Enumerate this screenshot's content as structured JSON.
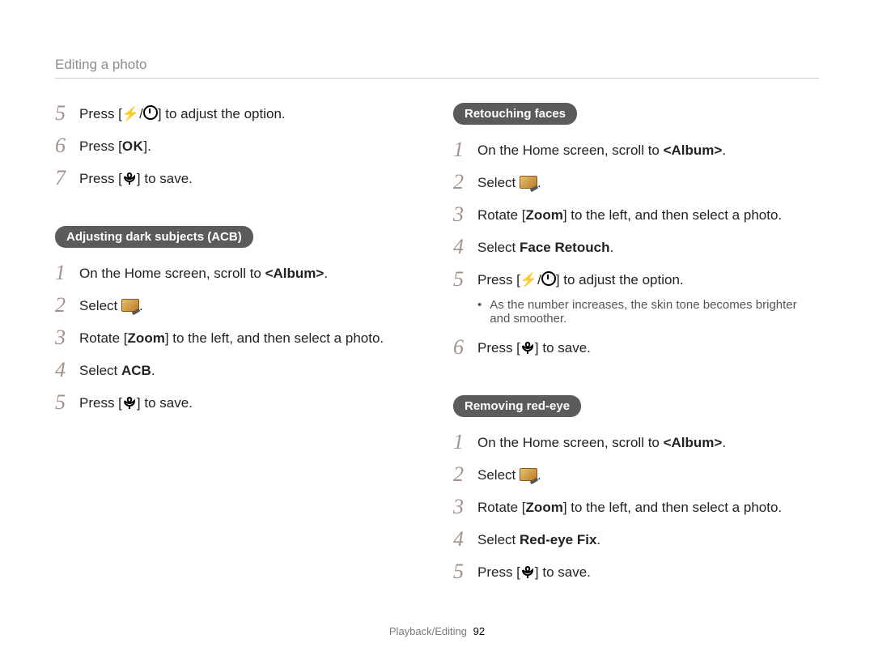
{
  "header": "Editing a photo",
  "footer": {
    "section": "Playback/Editing",
    "page": "92"
  },
  "icons": {
    "flash": "icon-flash",
    "timer": "icon-timer",
    "ok": "icon-ok",
    "macro": "icon-macro",
    "edit": "icon-edit"
  },
  "left": {
    "introSteps": [
      {
        "n": "5",
        "pre": "Press [",
        "iconA": "flash",
        "sep": "/",
        "iconB": "timer",
        "post": "] to adjust the option."
      },
      {
        "n": "6",
        "pre": "Press [",
        "iconA": "ok",
        "post": "]."
      },
      {
        "n": "7",
        "pre": "Press [",
        "iconA": "macro",
        "post": "] to save."
      }
    ],
    "pill": "Adjusting dark subjects (ACB)",
    "steps": [
      {
        "n": "1",
        "textA": "On the Home screen, scroll to ",
        "bold": "<Album>",
        "textB": "."
      },
      {
        "n": "2",
        "textA": "Select ",
        "iconA": "edit",
        "textB": "."
      },
      {
        "n": "3",
        "textA": "Rotate [",
        "bold": "Zoom",
        "textB": "] to the left, and then select a photo."
      },
      {
        "n": "4",
        "textA": "Select ",
        "bold": "ACB",
        "textB": "."
      },
      {
        "n": "5",
        "pre": "Press [",
        "iconA": "macro",
        "post": "] to save."
      }
    ]
  },
  "right": {
    "sections": [
      {
        "pill": "Retouching faces",
        "steps": [
          {
            "n": "1",
            "textA": "On the Home screen, scroll to ",
            "bold": "<Album>",
            "textB": "."
          },
          {
            "n": "2",
            "textA": "Select ",
            "iconA": "edit",
            "textB": "."
          },
          {
            "n": "3",
            "textA": "Rotate [",
            "bold": "Zoom",
            "textB": "] to the left, and then select a photo."
          },
          {
            "n": "4",
            "textA": "Select ",
            "bold": "Face Retouch",
            "textB": "."
          },
          {
            "n": "5",
            "pre": "Press [",
            "iconA": "flash",
            "sep": "/",
            "iconB": "timer",
            "post": "] to adjust the option."
          }
        ],
        "note": "As the number increases, the skin tone becomes brighter and smoother.",
        "afterNote": [
          {
            "n": "6",
            "pre": "Press [",
            "iconA": "macro",
            "post": "] to save."
          }
        ]
      },
      {
        "pill": "Removing red-eye",
        "steps": [
          {
            "n": "1",
            "textA": "On the Home screen, scroll to ",
            "bold": "<Album>",
            "textB": "."
          },
          {
            "n": "2",
            "textA": "Select ",
            "iconA": "edit",
            "textB": "."
          },
          {
            "n": "3",
            "textA": "Rotate [",
            "bold": "Zoom",
            "textB": "] to the left, and then select a photo."
          },
          {
            "n": "4",
            "textA": "Select ",
            "bold": "Red-eye Fix",
            "textB": "."
          },
          {
            "n": "5",
            "pre": "Press [",
            "iconA": "macro",
            "post": "] to save."
          }
        ]
      }
    ]
  }
}
